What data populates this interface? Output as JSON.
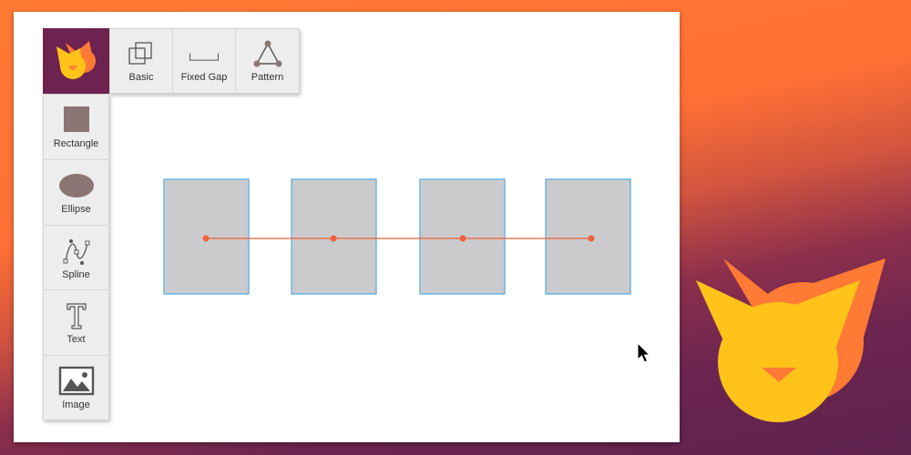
{
  "colors": {
    "brand_purple": "#6e2250",
    "cat_yellow": "#ffc31a",
    "cat_orange": "#ff7a34",
    "shape_fill": "#cbcbcd",
    "shape_border": "#5aaee0",
    "connector": "#f0603a",
    "icon_gray": "#8a7474"
  },
  "logo": {
    "icon": "cat-logo-icon"
  },
  "top_toolbar": {
    "items": [
      {
        "label": "Basic",
        "icon": "basic-layers-icon"
      },
      {
        "label": "Fixed Gap",
        "icon": "fixed-gap-icon"
      },
      {
        "label": "Pattern",
        "icon": "pattern-triangle-icon"
      }
    ]
  },
  "side_toolbar": {
    "items": [
      {
        "label": "Rectangle",
        "icon": "rectangle-icon"
      },
      {
        "label": "Ellipse",
        "icon": "ellipse-icon"
      },
      {
        "label": "Spline",
        "icon": "spline-icon"
      },
      {
        "label": "Text",
        "icon": "text-icon"
      },
      {
        "label": "Image",
        "icon": "image-icon"
      }
    ]
  },
  "canvas": {
    "shapes": [
      {
        "type": "rectangle"
      },
      {
        "type": "rectangle"
      },
      {
        "type": "rectangle"
      },
      {
        "type": "rectangle"
      }
    ],
    "connector": {
      "type": "line",
      "points": 4
    }
  }
}
